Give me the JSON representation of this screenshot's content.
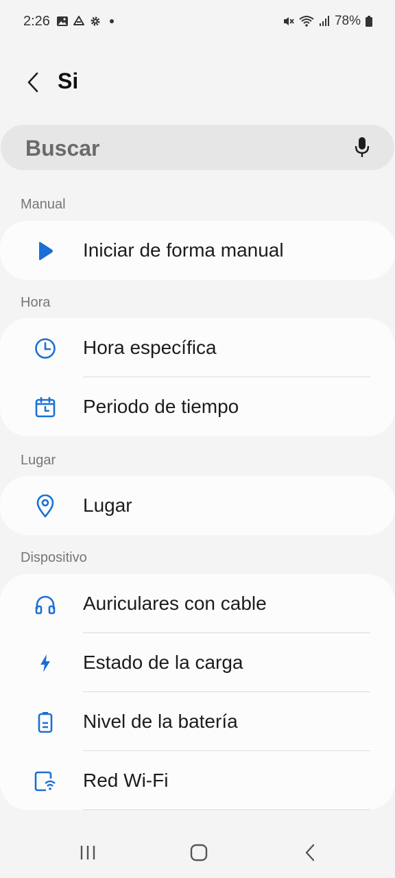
{
  "status_bar": {
    "time": "2:26",
    "battery": "78%",
    "left_icons": [
      "image-icon",
      "drive-icon",
      "settings-icon",
      "dot-icon"
    ],
    "right_icons": [
      "mute-icon",
      "wifi-icon",
      "signal-icon",
      "battery-icon"
    ]
  },
  "header": {
    "title": "Si"
  },
  "search": {
    "placeholder": "Buscar"
  },
  "sections": {
    "manual": {
      "title": "Manual",
      "items": [
        {
          "label": "Iniciar de forma manual",
          "icon": "play-icon"
        }
      ]
    },
    "hora": {
      "title": "Hora",
      "items": [
        {
          "label": "Hora específica",
          "icon": "clock-icon"
        },
        {
          "label": "Periodo de tiempo",
          "icon": "calendar-icon"
        }
      ]
    },
    "lugar": {
      "title": "Lugar",
      "items": [
        {
          "label": "Lugar",
          "icon": "location-pin-icon"
        }
      ]
    },
    "dispositivo": {
      "title": "Dispositivo",
      "items": [
        {
          "label": "Auriculares con cable",
          "icon": "headphones-icon"
        },
        {
          "label": "Estado de la carga",
          "icon": "bolt-icon"
        },
        {
          "label": "Nivel de la batería",
          "icon": "battery-level-icon"
        },
        {
          "label": "Red Wi-Fi",
          "icon": "wifi-device-icon"
        }
      ]
    }
  },
  "colors": {
    "accent": "#1a6fd6",
    "background": "#f4f4f4",
    "card": "#fcfcfc"
  },
  "navbar": {
    "icons": [
      "recents-icon",
      "home-icon",
      "back-nav-icon"
    ]
  }
}
